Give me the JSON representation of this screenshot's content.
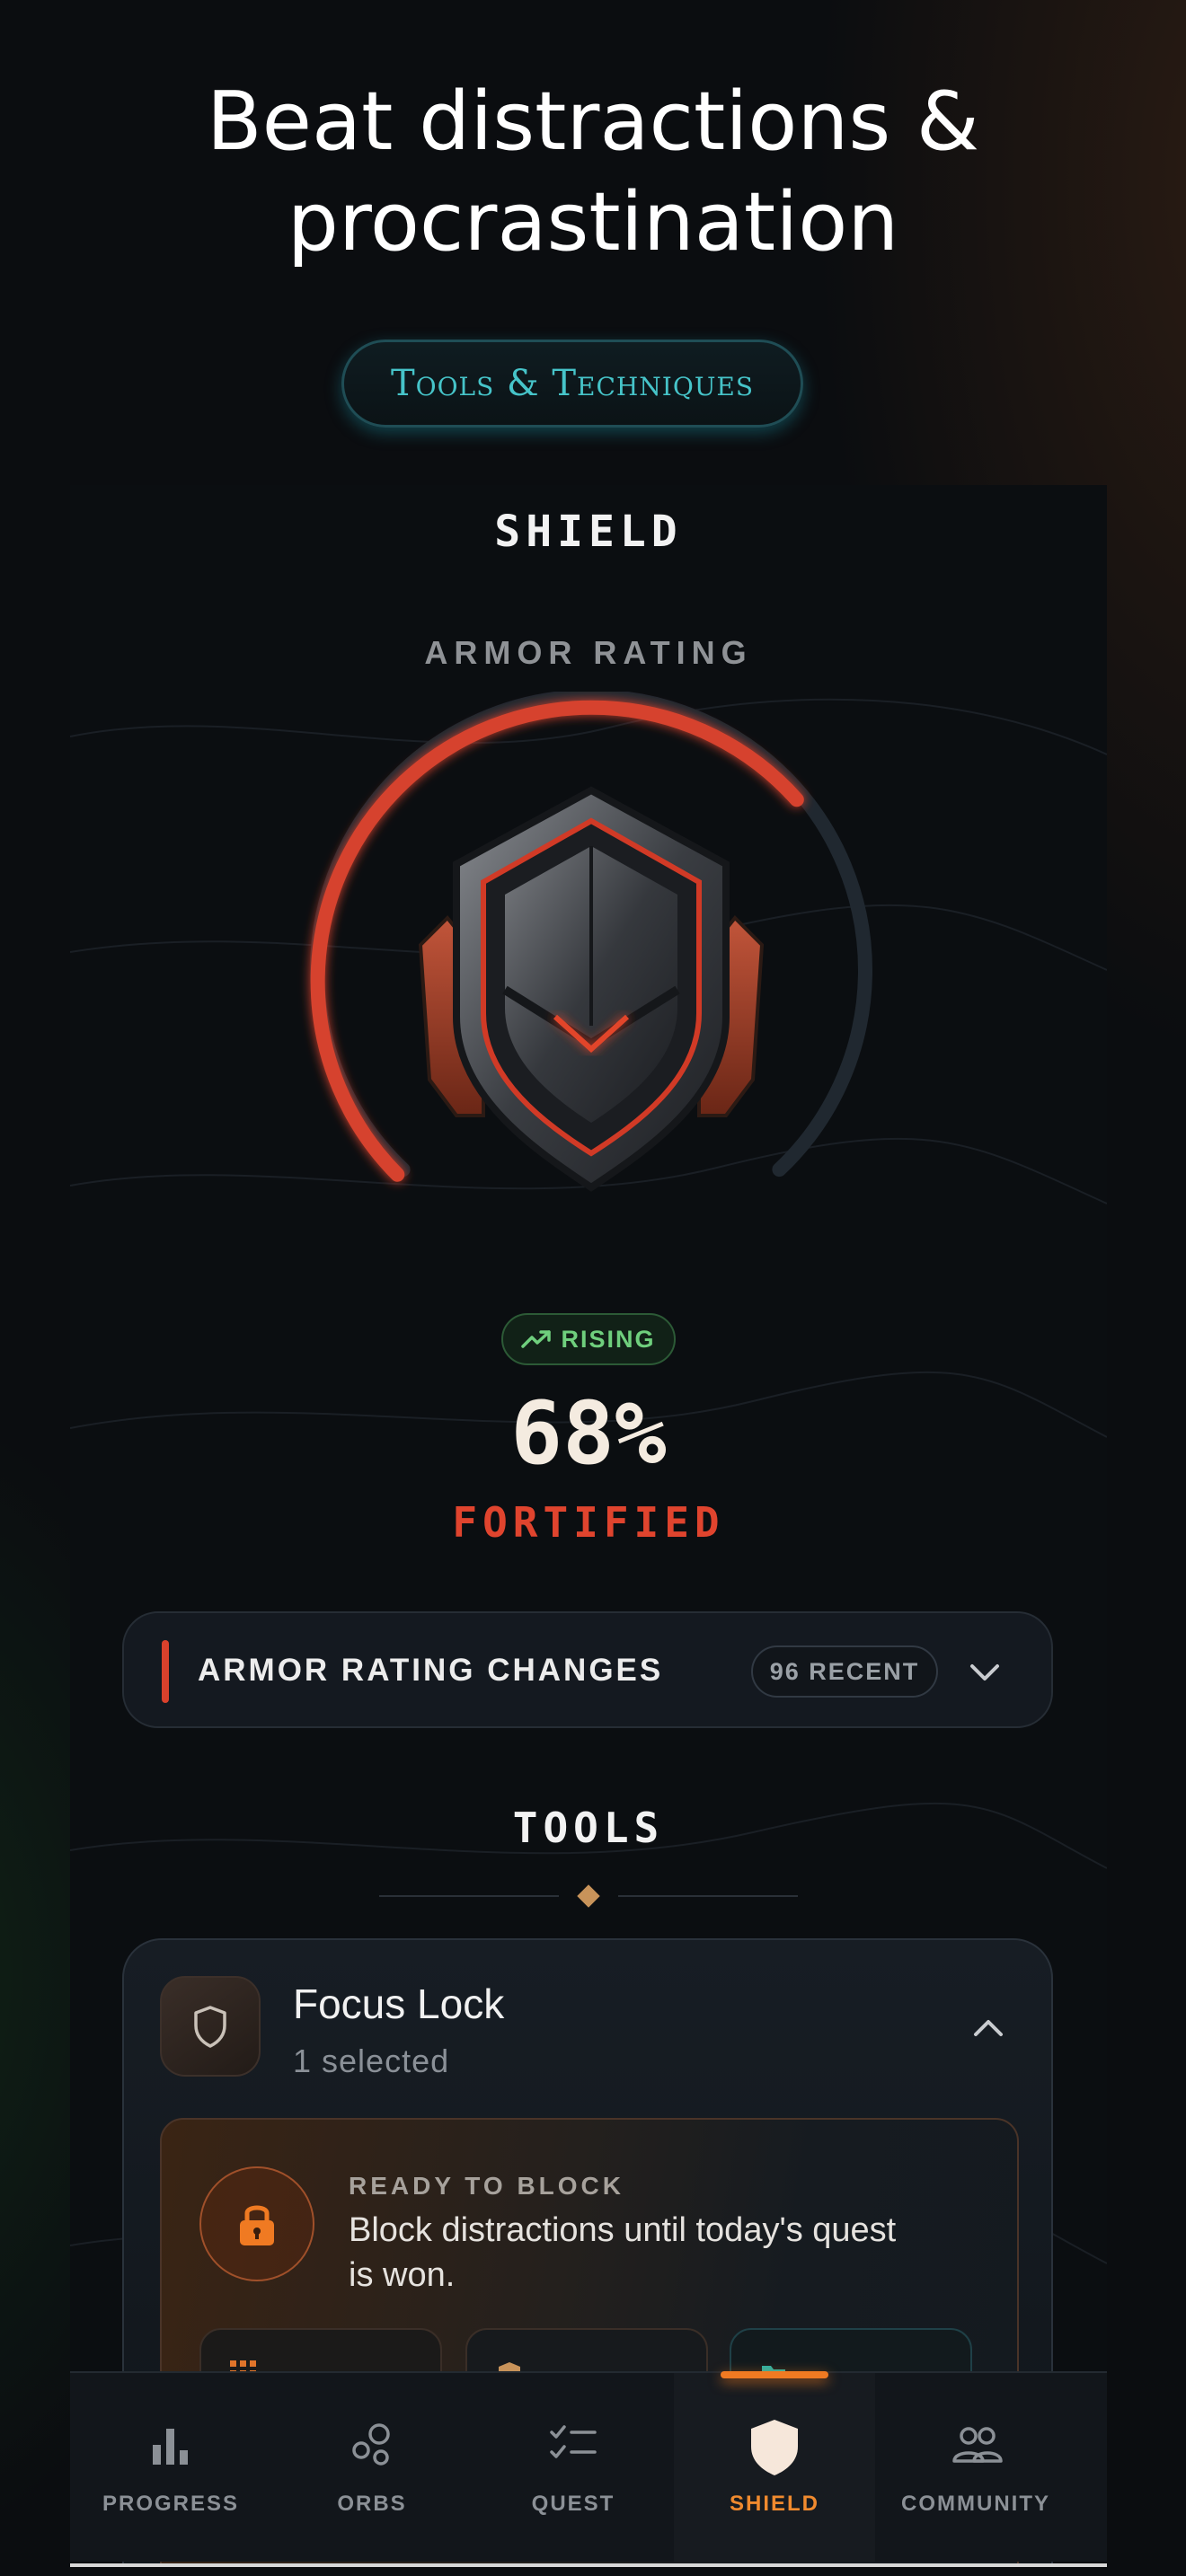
{
  "headline": "Beat distractions & procrastination",
  "tools_pill": "Tools & Techniques",
  "shield": {
    "title": "SHIELD",
    "armor_label": "ARMOR RATING",
    "armor_rating_percent": 68,
    "trend": "RISING",
    "percent_text": "68%",
    "status": "FORTIFIED"
  },
  "changes": {
    "label": "ARMOR RATING CHANGES",
    "badge": "96 RECENT"
  },
  "tools": {
    "title": "TOOLS",
    "focus_lock": {
      "title": "Focus Lock",
      "subtitle": "1 selected",
      "ready_label": "READY TO BLOCK",
      "ready_text": "Block distractions until today's quest is won."
    }
  },
  "tabs": [
    {
      "label": "PROGRESS",
      "icon": "bar-chart-icon"
    },
    {
      "label": "ORBS",
      "icon": "orbs-icon"
    },
    {
      "label": "QUEST",
      "icon": "checklist-icon"
    },
    {
      "label": "SHIELD",
      "icon": "shield-icon",
      "active": true
    },
    {
      "label": "COMMUNITY",
      "icon": "people-icon"
    }
  ],
  "colors": {
    "accent_red": "#e0442e",
    "accent_orange": "#f07a22",
    "teal": "#46c4c9",
    "rising_green": "#6fcf7d"
  }
}
